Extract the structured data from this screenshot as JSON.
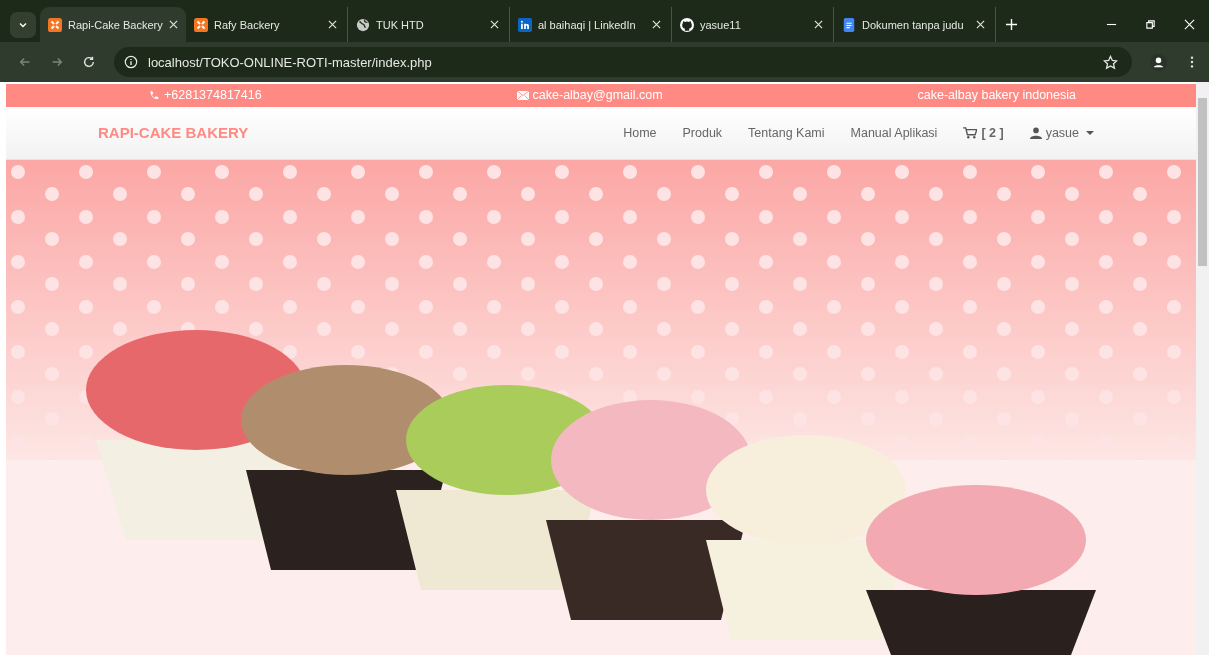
{
  "browser": {
    "tabs": [
      {
        "label": "Rapi-Cake Backery",
        "kind": "xampp",
        "selected": true
      },
      {
        "label": "Rafy Backery",
        "kind": "xampp",
        "selected": false
      },
      {
        "label": "TUK HTD",
        "kind": "globe",
        "selected": false
      },
      {
        "label": "al baihaqi | LinkedIn",
        "kind": "linkedin",
        "selected": false
      },
      {
        "label": "yasue11",
        "kind": "github",
        "selected": false
      },
      {
        "label": "Dokumen tanpa judu",
        "kind": "docs",
        "selected": false
      }
    ],
    "address": "localhost/TOKO-ONLINE-ROTI-master/index.php"
  },
  "top_bar": {
    "phone": "+6281374817416",
    "email": "cake-albay@gmail.com",
    "tagline": "cake-albay bakery indonesia"
  },
  "navbar": {
    "brand": "RAPI-CAKE BAKERY",
    "links": [
      "Home",
      "Produk",
      "Tentang Kami",
      "Manual Aplikasi"
    ],
    "cart": "[ 2 ]",
    "user": "yasue"
  }
}
